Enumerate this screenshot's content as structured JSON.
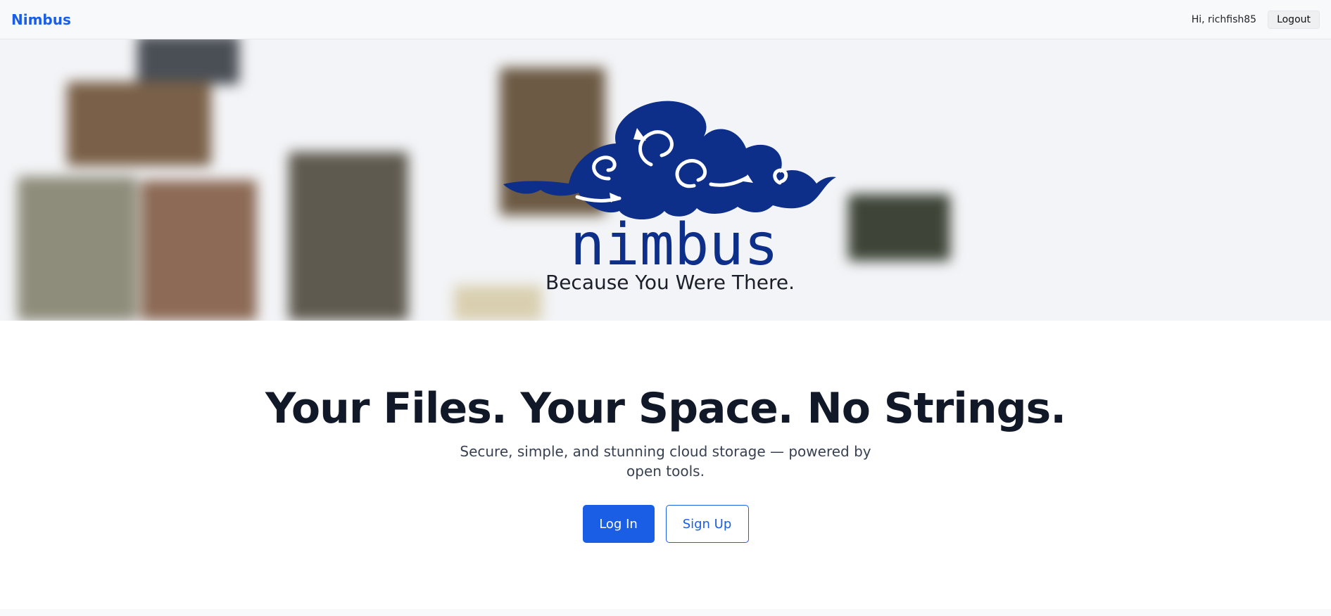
{
  "nav": {
    "brand": "Nimbus",
    "greeting": "Hi, richfish85",
    "logout_label": "Logout"
  },
  "hero": {
    "logo_wordmark": "nimbus",
    "tagline": "Because You Were There."
  },
  "main": {
    "headline": "Your Files. Your Space. No Strings.",
    "subheadline": "Secure, simple, and stunning cloud storage — powered by open tools.",
    "login_label": "Log In",
    "signup_label": "Sign Up"
  },
  "colors": {
    "brand_blue": "#1a5ee6",
    "logo_navy": "#0d2f8a",
    "headline": "#111827"
  }
}
